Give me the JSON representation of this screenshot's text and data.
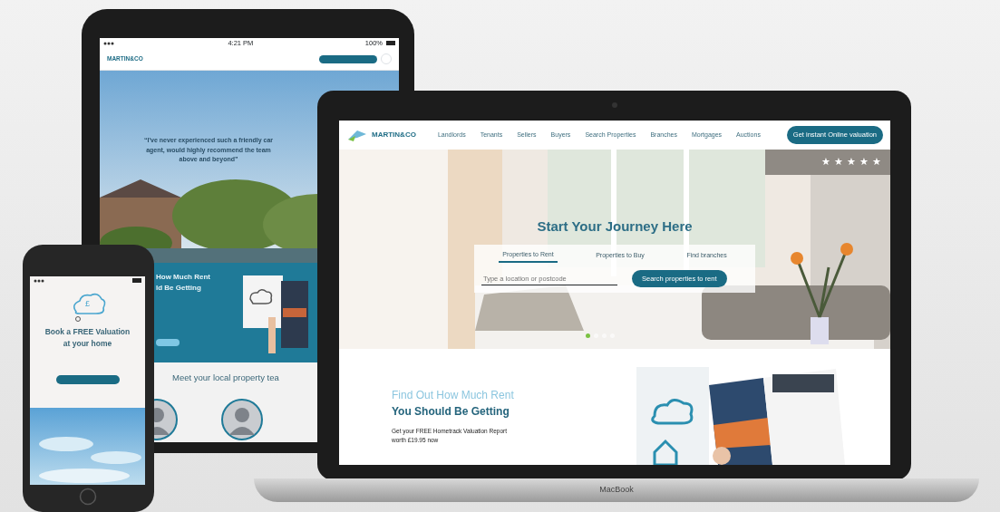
{
  "laptop": {
    "logo": "MARTIN&CO",
    "nav_links": [
      {
        "label": "Landlords"
      },
      {
        "label": "Tenants"
      },
      {
        "label": "Sellers"
      },
      {
        "label": "Buyers"
      },
      {
        "label": "Search Properties"
      },
      {
        "label": "Branches"
      },
      {
        "label": "Mortgages"
      },
      {
        "label": "Auctions"
      }
    ],
    "cta": "Get instant Online valuation",
    "rating": {
      "stars": 5
    },
    "hero": {
      "title": "Start Your Journey Here",
      "tabs": [
        {
          "label": "Properties to Rent",
          "selected": true
        },
        {
          "label": "Properties to Buy",
          "selected": false
        },
        {
          "label": "Find branches",
          "selected": false
        }
      ],
      "search": {
        "placeholder": "Type a location or postcode"
      },
      "search_button": "Search properties to rent",
      "carousel": [
        {
          "selected": true
        },
        {
          "selected": false
        },
        {
          "selected": false
        },
        {
          "selected": false
        }
      ]
    },
    "promo": {
      "heading_light": "Find Out How Much Rent",
      "heading_dark": "You Should Be Getting",
      "offer": "Get your FREE Hometrack Valuation Report worth £19.95 now"
    },
    "base_label": "MacBook"
  },
  "tablet": {
    "status": {
      "time": "4:21 PM",
      "battery": "100%"
    },
    "logo": "MARTIN&CO",
    "quote_lines": [
      "“I've never experienced such a friendly car",
      "agent, would highly recommend the team",
      "above and beyond”"
    ],
    "promo_lines": [
      "How Much Rent",
      "ld Be Getting"
    ],
    "team_heading": "Meet your local property tea"
  },
  "phone": {
    "cloud_symbol": "£",
    "title_lines": [
      "Book a FREE Valuation",
      "at your home"
    ]
  }
}
